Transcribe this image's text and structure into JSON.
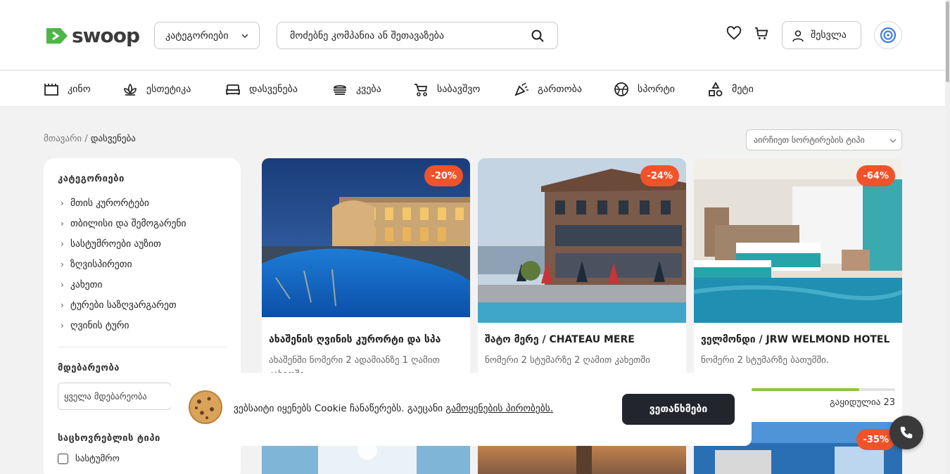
{
  "header": {
    "logo_text": "swoop",
    "categories_label": "კატეგორიები",
    "search_placeholder": "მოძებნე კომპანია ან შეთავაზება",
    "login_label": "შესვლა"
  },
  "category_nav": [
    {
      "label": "კინო",
      "icon": "cinema-icon"
    },
    {
      "label": "ესთეტიკა",
      "icon": "lotus-icon"
    },
    {
      "label": "დასვენება",
      "icon": "bed-icon"
    },
    {
      "label": "კვება",
      "icon": "burger-icon"
    },
    {
      "label": "საბავშვო",
      "icon": "stroller-icon"
    },
    {
      "label": "გართობა",
      "icon": "party-icon"
    },
    {
      "label": "სპორტი",
      "icon": "ball-icon"
    },
    {
      "label": "მეტი",
      "icon": "shapes-icon"
    }
  ],
  "breadcrumb": {
    "home": "მთავარი",
    "separator": "/",
    "current": "დასვენება"
  },
  "sort": {
    "placeholder": "აირჩიეთ სორტირების ტიპი"
  },
  "sidebar": {
    "categories_title": "კატეგორიები",
    "categories": [
      "მთის კურორტები",
      "თბილისი და შემოგარენი",
      "სასტუმროები აუზით",
      "ზღვისპირეთი",
      "კახეთი",
      "ტურები საზღვარგარეთ",
      "ღვინის ტური"
    ],
    "location_title": "მდებარეობა",
    "location_value": "ყველა მდებარეობა",
    "type_title": "საცხოვრებლის ტიპი",
    "type_option": "სასტუმრო"
  },
  "offers": [
    {
      "discount": "-20%",
      "title": "ახაშენის ღვინის კურორტი და სპა",
      "desc": "ახაშენში ნომერი 2 ადამიანზე 1 ღამით კახეთში"
    },
    {
      "discount": "-24%",
      "title": "შატო მერე / CHATEAU MERE",
      "desc": "ნომერი 2 სტუმარზე 2 ღამით კახეთში"
    },
    {
      "discount": "-64%",
      "title": "ველმონდი / JRW WELMOND HOTEL",
      "desc": "ნომერი 2 სტუმარზე ბათუმში.",
      "sold_label": "გაყიდულია 23",
      "sold_progress_pct": 75
    }
  ],
  "offers_row2": [
    {
      "discount": ""
    },
    {
      "discount": ""
    },
    {
      "discount": "-35%"
    }
  ],
  "cookie": {
    "text_before": "ვებსაიტი იყენებს Cookie ჩანაწერებს. გაეცანი ",
    "link_text": "გამოყენების პირობებს.",
    "accept_label": "ვეთანხმები"
  },
  "colors": {
    "accent": "#f0532a",
    "brand_green": "#4cb748",
    "progress": "#8bc53f",
    "dark_button": "#23252e"
  }
}
